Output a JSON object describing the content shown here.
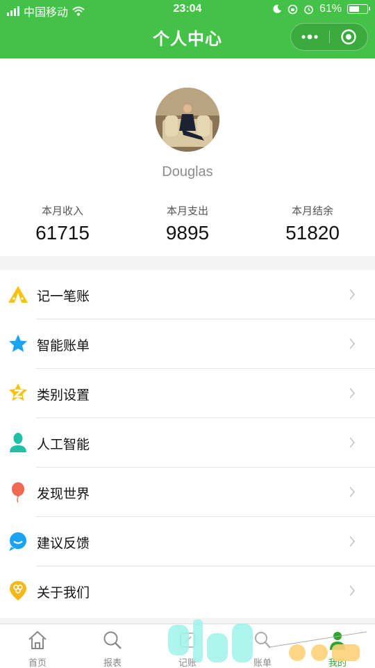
{
  "status_bar": {
    "carrier": "中国移动",
    "time": "23:04",
    "battery": "61%",
    "battery_level": 0.61
  },
  "nav": {
    "title": "个人中心"
  },
  "profile": {
    "username": "Douglas",
    "stats": [
      {
        "label": "本月收入",
        "value": "61715"
      },
      {
        "label": "本月支出",
        "value": "9895"
      },
      {
        "label": "本月结余",
        "value": "51820"
      }
    ]
  },
  "menu": {
    "items": [
      {
        "label": "记一笔账",
        "icon": "tent-icon",
        "color": "#f5c211"
      },
      {
        "label": "智能账单",
        "icon": "star-icon",
        "color": "#1aa3f0"
      },
      {
        "label": "类别设置",
        "icon": "z-badge-icon",
        "color": "#f5c211"
      },
      {
        "label": "人工智能",
        "icon": "person-icon",
        "color": "#21bfa5"
      },
      {
        "label": "发现世界",
        "icon": "balloon-icon",
        "color": "#f06952"
      },
      {
        "label": "建议反馈",
        "icon": "chat-bubble-icon",
        "color": "#1aa3f0"
      },
      {
        "label": "关于我们",
        "icon": "location-pin-icon",
        "color": "#f5b81a"
      }
    ]
  },
  "tabbar": {
    "tabs": [
      {
        "label": "首页",
        "icon": "home-icon"
      },
      {
        "label": "报表",
        "icon": "search-icon"
      },
      {
        "label": "记账",
        "icon": "edit-icon"
      },
      {
        "label": "账单",
        "icon": "bill-icon"
      },
      {
        "label": "我的",
        "icon": "user-icon",
        "active": true
      }
    ]
  },
  "colors": {
    "brand_green": "#44c247",
    "tab_active": "#2fa52f"
  }
}
